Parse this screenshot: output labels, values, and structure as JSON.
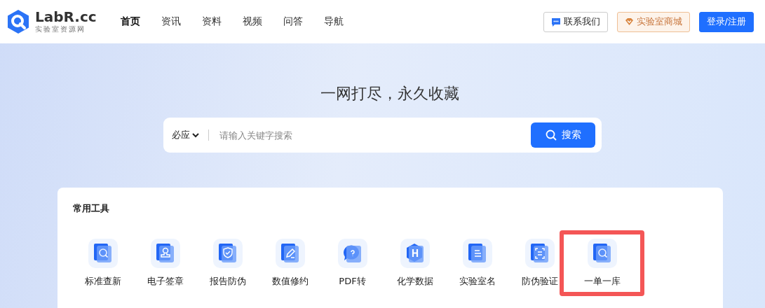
{
  "logo": {
    "name": "LabR.cc",
    "tagline": "实验室资源网"
  },
  "nav": [
    {
      "label": "首页",
      "selected": true
    },
    {
      "label": "资讯",
      "selected": false
    },
    {
      "label": "资料",
      "selected": false
    },
    {
      "label": "视频",
      "selected": false
    },
    {
      "label": "问答",
      "selected": false
    },
    {
      "label": "导航",
      "selected": false
    }
  ],
  "header_buttons": [
    {
      "label": "联系我们",
      "kind": "contact"
    },
    {
      "label": "实验室商城",
      "kind": "shop"
    },
    {
      "label": "登录/注册",
      "kind": "login"
    }
  ],
  "hero": {
    "title": "一网打尽，永久收藏"
  },
  "search": {
    "scope": "必应",
    "placeholder": "请输入关键字搜索",
    "button": "搜索"
  },
  "tools": {
    "title": "常用工具",
    "items": [
      {
        "label": "标准查新",
        "highlighted": false
      },
      {
        "label": "电子签章",
        "highlighted": false
      },
      {
        "label": "报告防伪",
        "highlighted": false
      },
      {
        "label": "数值修约",
        "highlighted": false
      },
      {
        "label": "PDF转",
        "highlighted": false
      },
      {
        "label": "化学数据",
        "highlighted": false
      },
      {
        "label": "实验室名",
        "highlighted": false
      },
      {
        "label": "防伪验证",
        "highlighted": false
      },
      {
        "label": "一单一库",
        "highlighted": true
      }
    ]
  }
}
